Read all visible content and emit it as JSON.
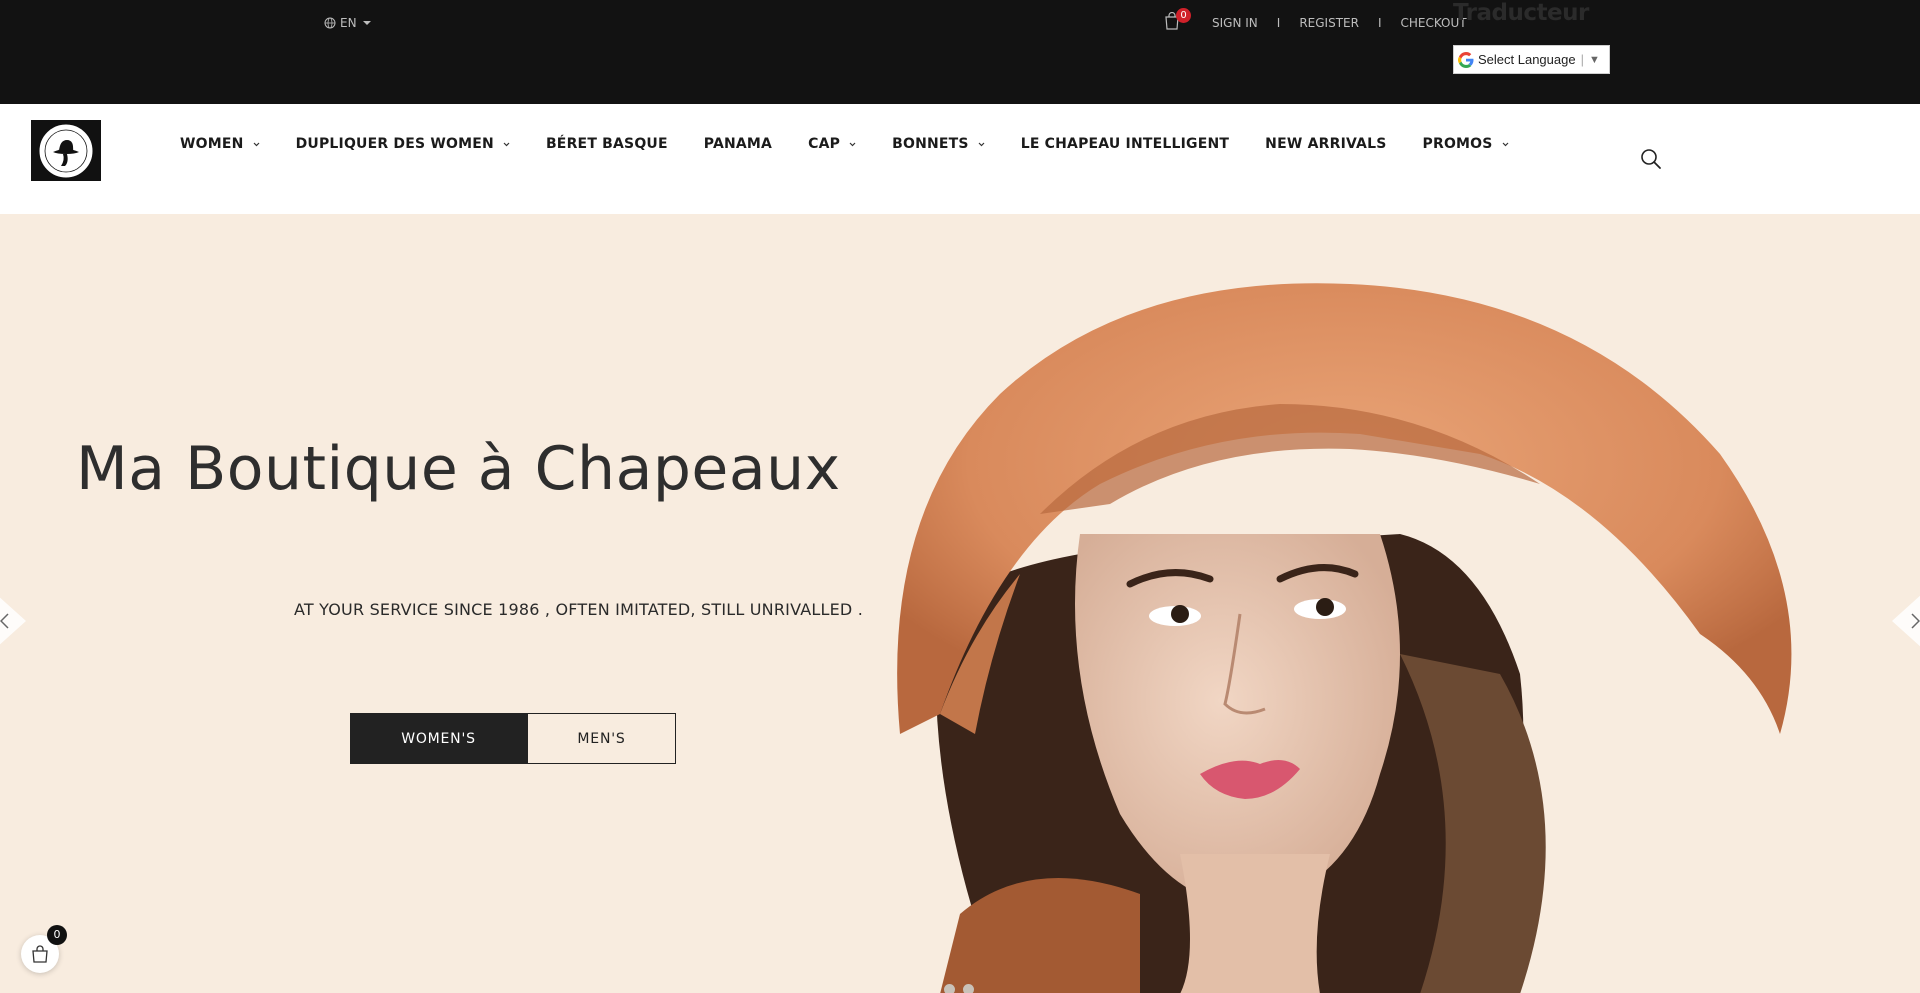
{
  "topbar": {
    "language": "EN",
    "cart_count": "0",
    "account_links": [
      "SIGN IN",
      "REGISTER",
      "CHECKOUT"
    ],
    "separator": "I",
    "translator_title": "Traducteur",
    "translator_select": "Select Language",
    "translator_sep": "|",
    "translator_arrow": "▼"
  },
  "nav": {
    "items": [
      {
        "label": "WOMEN",
        "dropdown": true
      },
      {
        "label": "DUPLIQUER DES WOMEN",
        "dropdown": true
      },
      {
        "label": "BÉRET BASQUE",
        "dropdown": false
      },
      {
        "label": "PANAMA",
        "dropdown": false
      },
      {
        "label": "CAP",
        "dropdown": true
      },
      {
        "label": "BONNETS",
        "dropdown": true
      },
      {
        "label": "LE CHAPEAU INTELLIGENT",
        "dropdown": false
      },
      {
        "label": "NEW ARRIVALS",
        "dropdown": false
      },
      {
        "label": "PROMOS",
        "dropdown": true
      }
    ]
  },
  "hero": {
    "title": "Ma Boutique à Chapeaux",
    "tagline": "AT YOUR SERVICE SINCE 1986 , OFTEN IMITATED, STILL UNRIVALLED .",
    "cta_women": "WOMEN'S",
    "cta_men": "MEN'S",
    "slide_count": 2,
    "active_slide": 1
  },
  "floating_cart": {
    "count": "0"
  },
  "colors": {
    "topbar_bg": "#121212",
    "hero_bg": "#f8ecdf",
    "hat_orange": "#d98a5c",
    "badge_red": "#d0212a"
  }
}
